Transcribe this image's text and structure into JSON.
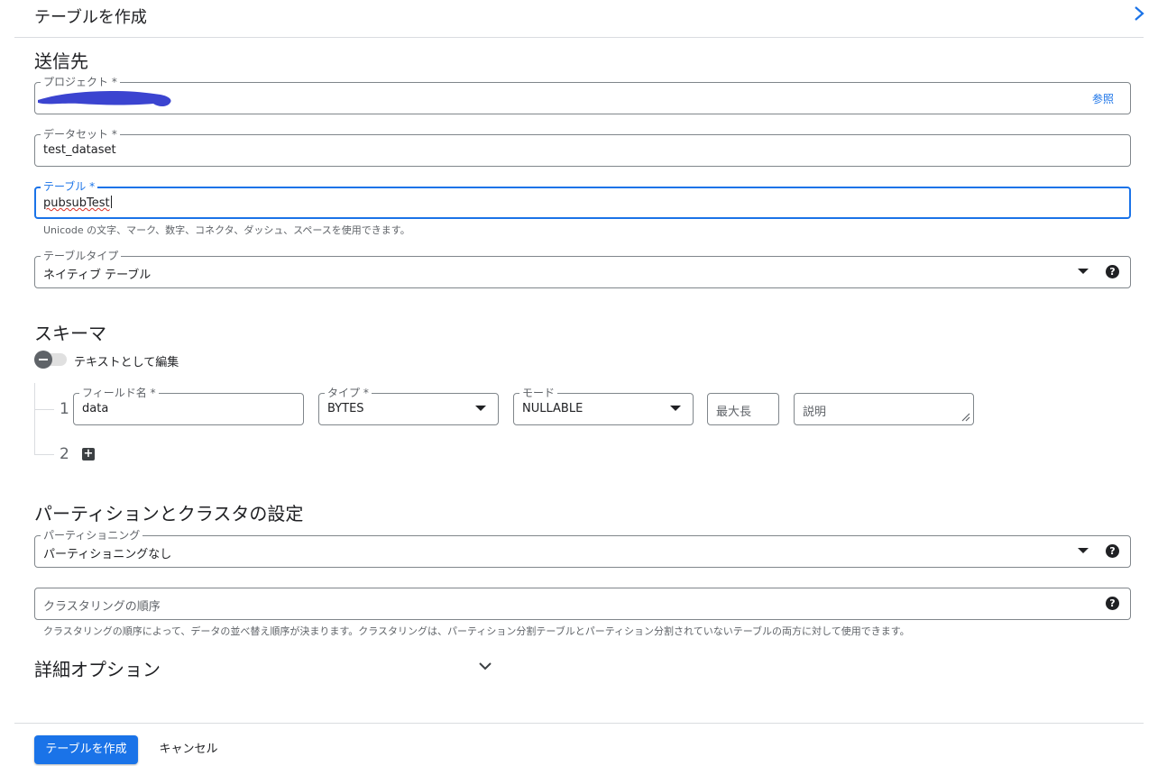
{
  "header": {
    "title": "テーブルを作成",
    "close_icon": "chevron-right-icon"
  },
  "destination": {
    "section_title": "送信先",
    "project": {
      "label": "プロジェクト *",
      "value": "",
      "browse_label": "参照"
    },
    "dataset": {
      "label": "データセット *",
      "value": "test_dataset"
    },
    "table": {
      "label": "テーブル *",
      "value": "pubsubTest",
      "hint": "Unicode の文字、マーク、数字、コネクタ、ダッシュ、スペースを使用できます。"
    },
    "table_type": {
      "label": "テーブルタイプ",
      "value": "ネイティブ テーブル"
    }
  },
  "schema": {
    "section_title": "スキーマ",
    "edit_as_text_label": "テキストとして編集",
    "rows": [
      {
        "number": "1",
        "field_name": {
          "label": "フィールド名 *",
          "value": "data"
        },
        "type": {
          "label": "タイプ *",
          "value": "BYTES"
        },
        "mode": {
          "label": "モード",
          "value": "NULLABLE"
        },
        "max_length_placeholder": "最大長",
        "description_placeholder": "説明"
      }
    ],
    "add_row_number": "2"
  },
  "partitioning": {
    "section_title": "パーティションとクラスタの設定",
    "partition": {
      "label": "パーティショニング",
      "value": "パーティショニングなし"
    },
    "clustering": {
      "placeholder": "クラスタリングの順序",
      "hint": "クラスタリングの順序によって、データの並べ替え順序が決まります。クラスタリングは、パーティション分割テーブルとパーティション分割されていないテーブルの両方に対して使用できます。"
    }
  },
  "advanced": {
    "title": "詳細オプション"
  },
  "footer": {
    "create_label": "テーブルを作成",
    "cancel_label": "キャンセル"
  },
  "colors": {
    "accent": "#1a73e8",
    "redaction": "#3b44d0",
    "border": "#80868b",
    "error": "#d93025"
  }
}
